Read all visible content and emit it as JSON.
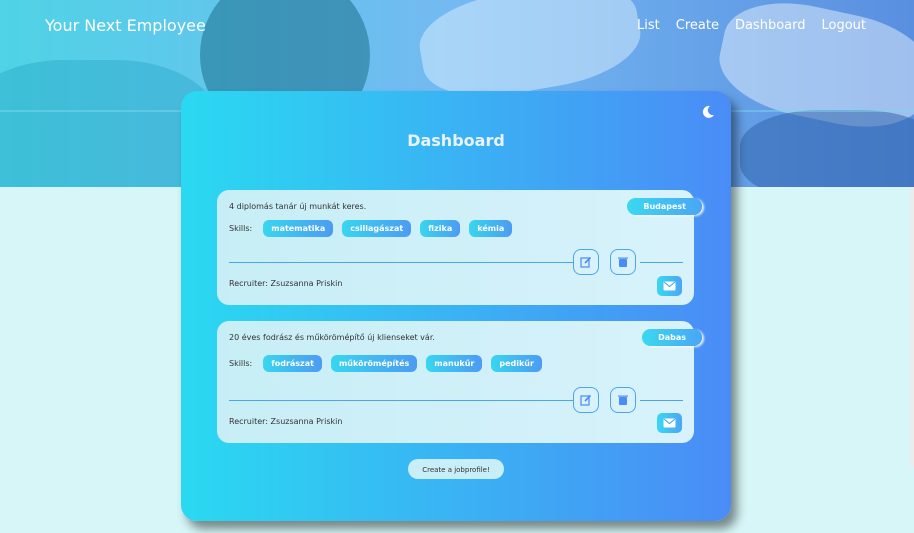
{
  "nav": {
    "brand": "Your Next Employee",
    "links": [
      "List",
      "Create",
      "Dashboard",
      "Logout"
    ]
  },
  "dashboard": {
    "title": "Dashboard",
    "theme_icon": "moon-icon",
    "cards": [
      {
        "description": "4 diplomás tanár új munkát keres.",
        "location": "Budapest",
        "skills_label": "Skills:",
        "skills": [
          "matematika",
          "csillagászat",
          "fizika",
          "kémia"
        ],
        "recruiter": "Recruiter: Zsuzsanna Priskin"
      },
      {
        "description": "20 éves fodrász és műkörömépítő új klienseket vár.",
        "location": "Dabas",
        "skills_label": "Skills:",
        "skills": [
          "fodrászat",
          "műkörömépítés",
          "manukűr",
          "pedikűr"
        ],
        "recruiter": "Recruiter: Zsuzsanna Priskin"
      }
    ],
    "create_button": "Create a jobprofile!"
  },
  "colors": {
    "accent_start": "#2ad9f1",
    "accent_end": "#4a8cf6",
    "page_background": "#d7f6f7"
  }
}
